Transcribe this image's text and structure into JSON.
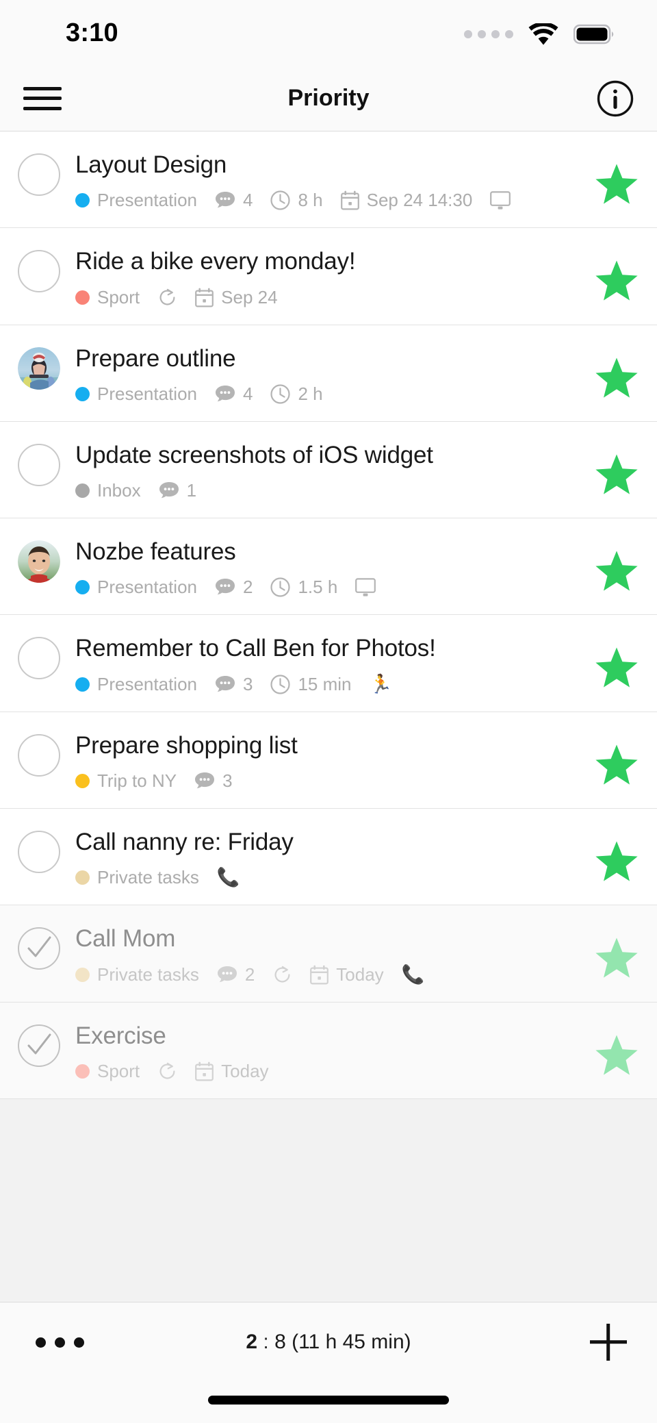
{
  "status_bar": {
    "time": "3:10",
    "signal_icon": "signal-dots-icon",
    "wifi_icon": "wifi-icon",
    "battery_icon": "battery-full-icon"
  },
  "header": {
    "menu_icon": "hamburger-menu-icon",
    "title": "Priority",
    "info_icon": "info-circle-icon"
  },
  "colors": {
    "star_active": "#2ECC5E",
    "star_done": "#93E5AE",
    "project_presentation": "#16AEF0",
    "project_sport": "#F98377",
    "project_inbox": "#A8A8A8",
    "project_trip": "#FAC01E",
    "project_private": "#EBD6A6",
    "project_sport_done": "#FBBFB8",
    "project_private_done": "#F2E4C6",
    "row_bg": "#FFFFFF",
    "row_done_bg": "#FAFAFA",
    "meta_text": "#ACACAC",
    "title_text": "#1A1A1A"
  },
  "tasks": [
    {
      "title": "Layout Design",
      "completed": false,
      "checkbox": "unchecked-circle",
      "avatar": null,
      "starred": true,
      "meta": [
        {
          "kind": "project",
          "icon": "project-dot-icon",
          "color": "#16AEF0",
          "label": "Presentation"
        },
        {
          "kind": "comments",
          "icon": "comment-bubble-icon",
          "label": "4"
        },
        {
          "kind": "time",
          "icon": "clock-icon",
          "label": "8 h"
        },
        {
          "kind": "date",
          "icon": "calendar-icon",
          "label": "Sep 24 14:30"
        },
        {
          "kind": "category",
          "icon": "monitor-icon",
          "label": ""
        }
      ]
    },
    {
      "title": "Ride a bike every monday!",
      "completed": false,
      "checkbox": "unchecked-circle",
      "avatar": null,
      "starred": true,
      "meta": [
        {
          "kind": "project",
          "icon": "project-dot-icon",
          "color": "#F98377",
          "label": "Sport"
        },
        {
          "kind": "repeat",
          "icon": "repeat-icon",
          "label": ""
        },
        {
          "kind": "date",
          "icon": "calendar-icon",
          "label": "Sep 24"
        }
      ]
    },
    {
      "title": "Prepare outline",
      "completed": false,
      "checkbox": "avatar",
      "avatar": "cyclist-photo",
      "starred": true,
      "meta": [
        {
          "kind": "project",
          "icon": "project-dot-icon",
          "color": "#16AEF0",
          "label": "Presentation"
        },
        {
          "kind": "comments",
          "icon": "comment-bubble-icon",
          "label": "4"
        },
        {
          "kind": "time",
          "icon": "clock-icon",
          "label": "2 h"
        }
      ]
    },
    {
      "title": "Update screenshots of iOS widget",
      "completed": false,
      "checkbox": "unchecked-circle",
      "avatar": null,
      "starred": true,
      "meta": [
        {
          "kind": "project",
          "icon": "project-dot-icon",
          "color": "#A8A8A8",
          "label": "Inbox"
        },
        {
          "kind": "comments",
          "icon": "comment-bubble-icon",
          "label": "1"
        }
      ]
    },
    {
      "title": "Nozbe features",
      "completed": false,
      "checkbox": "avatar",
      "avatar": "man-portrait-photo",
      "starred": true,
      "meta": [
        {
          "kind": "project",
          "icon": "project-dot-icon",
          "color": "#16AEF0",
          "label": "Presentation"
        },
        {
          "kind": "comments",
          "icon": "comment-bubble-icon",
          "label": "2"
        },
        {
          "kind": "time",
          "icon": "clock-icon",
          "label": "1.5 h"
        },
        {
          "kind": "category",
          "icon": "monitor-icon",
          "label": ""
        }
      ]
    },
    {
      "title": "Remember to Call Ben for Photos!",
      "completed": false,
      "checkbox": "unchecked-circle",
      "avatar": null,
      "starred": true,
      "meta": [
        {
          "kind": "project",
          "icon": "project-dot-icon",
          "color": "#16AEF0",
          "label": "Presentation"
        },
        {
          "kind": "comments",
          "icon": "comment-bubble-icon",
          "label": "3"
        },
        {
          "kind": "time",
          "icon": "clock-icon",
          "label": "15 min"
        },
        {
          "kind": "category",
          "icon": "runner-icon",
          "label": ""
        }
      ]
    },
    {
      "title": "Prepare shopping list",
      "completed": false,
      "checkbox": "unchecked-circle",
      "avatar": null,
      "starred": true,
      "meta": [
        {
          "kind": "project",
          "icon": "project-dot-icon",
          "color": "#FAC01E",
          "label": "Trip to NY"
        },
        {
          "kind": "comments",
          "icon": "comment-bubble-icon",
          "label": "3"
        }
      ]
    },
    {
      "title": "Call nanny re: Friday",
      "completed": false,
      "checkbox": "unchecked-circle",
      "avatar": null,
      "starred": true,
      "meta": [
        {
          "kind": "project",
          "icon": "project-dot-icon",
          "color": "#EBD6A6",
          "label": "Private tasks"
        },
        {
          "kind": "category",
          "icon": "phone-icon",
          "label": ""
        }
      ]
    },
    {
      "title": "Call Mom",
      "completed": true,
      "checkbox": "checked-circle",
      "avatar": null,
      "starred": true,
      "meta": [
        {
          "kind": "project",
          "icon": "project-dot-icon",
          "color": "#F2E4C6",
          "label": "Private tasks"
        },
        {
          "kind": "comments",
          "icon": "comment-bubble-icon",
          "label": "2"
        },
        {
          "kind": "repeat",
          "icon": "repeat-icon",
          "label": ""
        },
        {
          "kind": "date",
          "icon": "calendar-icon",
          "label": "Today"
        },
        {
          "kind": "category",
          "icon": "phone-icon",
          "label": ""
        }
      ]
    },
    {
      "title": "Exercise",
      "completed": true,
      "checkbox": "checked-circle",
      "avatar": null,
      "starred": true,
      "meta": [
        {
          "kind": "project",
          "icon": "project-dot-icon",
          "color": "#FBBFB8",
          "label": "Sport"
        },
        {
          "kind": "repeat",
          "icon": "repeat-icon",
          "label": ""
        },
        {
          "kind": "date",
          "icon": "calendar-icon",
          "label": "Today"
        }
      ]
    }
  ],
  "bottom_bar": {
    "more_icon": "more-dots-icon",
    "completed_count": "2",
    "separator": ":",
    "total_summary": "8 (11 h 45 min)",
    "add_icon": "plus-icon"
  },
  "home_indicator": "home-bar-indicator"
}
